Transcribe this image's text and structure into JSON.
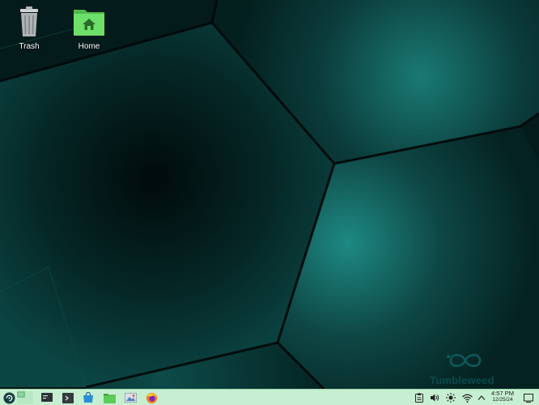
{
  "desktop": {
    "icons": [
      {
        "label": "Trash",
        "icon": "trash-icon"
      },
      {
        "label": "Home",
        "icon": "home-folder-icon"
      }
    ],
    "watermark": {
      "text": "Tumbleweed",
      "icon": "infinity-logo-icon"
    },
    "colors": {
      "panel": "#c6efd1",
      "wallpaper_glow": "#1d8a84",
      "wallpaper_dark": "#021413",
      "folder": "#6ee06a"
    }
  },
  "taskbar": {
    "launchers": [
      {
        "name": "application-launcher",
        "icon": "opensuse-logo-icon"
      },
      {
        "name": "virtual-desktop-pager",
        "icon": "pager-icon"
      },
      {
        "name": "system-monitor",
        "icon": "monitor-icon"
      },
      {
        "name": "terminal",
        "icon": "terminal-icon"
      },
      {
        "name": "software-store",
        "icon": "store-icon"
      },
      {
        "name": "file-manager",
        "icon": "folder-icon"
      },
      {
        "name": "image-viewer",
        "icon": "image-viewer-icon"
      },
      {
        "name": "firefox",
        "icon": "firefox-icon"
      }
    ],
    "tray": [
      {
        "name": "clipboard",
        "icon": "clipboard-icon"
      },
      {
        "name": "volume",
        "icon": "speaker-icon"
      },
      {
        "name": "brightness",
        "icon": "sun-icon"
      },
      {
        "name": "network",
        "icon": "wifi-icon"
      },
      {
        "name": "show-hidden",
        "icon": "chevron-up-icon"
      }
    ],
    "clock": {
      "time": "4:57 PM",
      "date": "12/25/24"
    },
    "show_desktop": {
      "icon": "show-desktop-icon"
    }
  }
}
